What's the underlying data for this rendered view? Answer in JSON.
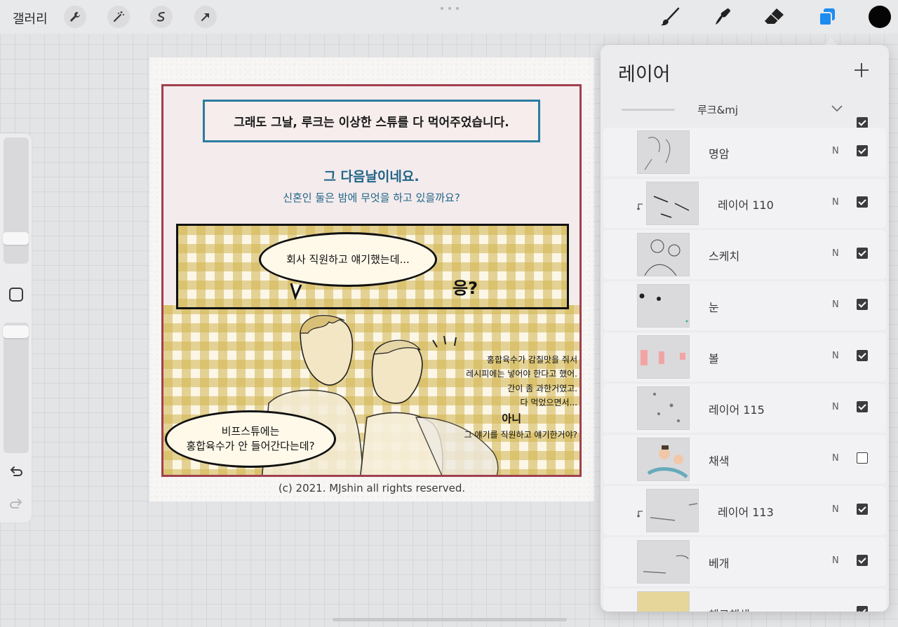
{
  "topbar": {
    "gallery_label": "갤러리",
    "left_tools": [
      "wrench-icon",
      "magic-wand-icon",
      "selection-icon",
      "transform-arrow-icon"
    ],
    "right_tools": [
      "brush-icon",
      "smudge-icon",
      "eraser-icon",
      "layers-icon"
    ],
    "current_color": "#050505",
    "active_tool_color": "#1d8cf0"
  },
  "comic": {
    "caption": "그래도 그날, 루크는 이상한 스튜를 다 먹어주었습니다.",
    "narration_1": "그 다음날이네요.",
    "narration_2": "신혼인 둘은 밤에 무엇을 하고 있을까요?",
    "bubble_top": "회사 직원하고 얘기했는데...",
    "sfx": "응?",
    "bubble_bottom_1": "비프스튜에는",
    "bubble_bottom_2": "홍합육수가 안 들어간다는데?",
    "side_1": "홍합육수가 감칠맛을 줘서",
    "side_2": "레시피에는 넣어야 한다고 했어.",
    "side_3": "간이 좀 과한거였고.",
    "side_4": "다 먹었으면서...",
    "side_5": "아니",
    "side_6": "그 얘기를 직원하고 얘기한거야?",
    "copyright": "(c) 2021. MJshin all rights reserved."
  },
  "layers": {
    "title": "레이어",
    "group": {
      "name": "루크&mj",
      "visible": true
    },
    "items": [
      {
        "name": "명암",
        "mode": "N",
        "visible": true,
        "clipped": false
      },
      {
        "name": "레이어 110",
        "mode": "N",
        "visible": true,
        "clipped": true
      },
      {
        "name": "스케치",
        "mode": "N",
        "visible": true,
        "clipped": false
      },
      {
        "name": "눈",
        "mode": "N",
        "visible": true,
        "clipped": false
      },
      {
        "name": "볼",
        "mode": "N",
        "visible": true,
        "clipped": false
      },
      {
        "name": "레이어 115",
        "mode": "N",
        "visible": true,
        "clipped": false
      },
      {
        "name": "채색",
        "mode": "N",
        "visible": false,
        "clipped": false
      },
      {
        "name": "레이어 113",
        "mode": "N",
        "visible": true,
        "clipped": true
      },
      {
        "name": "베개",
        "mode": "N",
        "visible": true,
        "clipped": false
      },
      {
        "name": "체크채색",
        "mode": "",
        "visible": true,
        "clipped": false
      }
    ]
  }
}
